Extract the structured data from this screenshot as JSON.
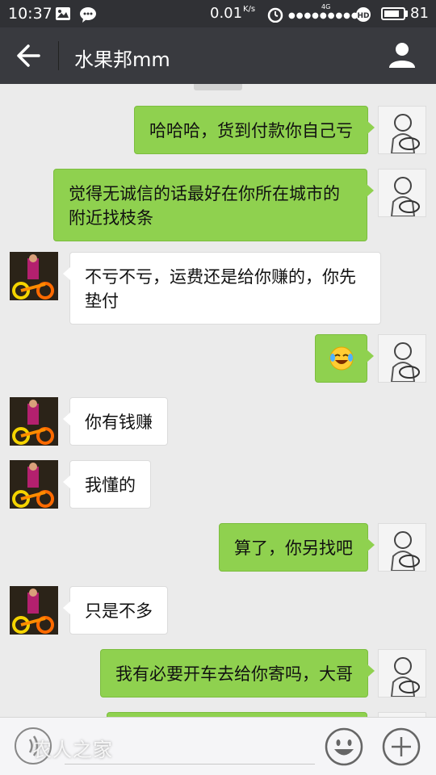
{
  "status_bar": {
    "time": "10:37",
    "speed": "0.01",
    "speed_unit": "K/s",
    "network": "4G",
    "battery": "81",
    "battery_level": 0.81
  },
  "header": {
    "title": "水果邦mm"
  },
  "messages": [
    {
      "side": "out",
      "text": "哈哈哈，货到付款你自己亏"
    },
    {
      "side": "out",
      "text": "觉得无诚信的话最好在你所在城市的附近找枝条"
    },
    {
      "side": "in",
      "text": "不亏不亏，运费还是给你赚的，你先垫付"
    },
    {
      "side": "out",
      "text": "",
      "emoji": "tears-of-joy-emoji"
    },
    {
      "side": "in",
      "text": "你有钱赚"
    },
    {
      "side": "in",
      "text": "我懂的"
    },
    {
      "side": "out",
      "text": "算了，你另找吧"
    },
    {
      "side": "in",
      "text": "只是不多"
    },
    {
      "side": "out",
      "text": "我有必要开车去给你寄吗，大哥"
    }
  ],
  "input_bar": {
    "watermark": "农人之家"
  },
  "colors": {
    "outgoing_bubble": "#8fd14f",
    "incoming_bubble": "#ffffff",
    "header_bg": "#393a3f",
    "status_bg": "#303135",
    "chat_bg": "#ebebeb"
  }
}
